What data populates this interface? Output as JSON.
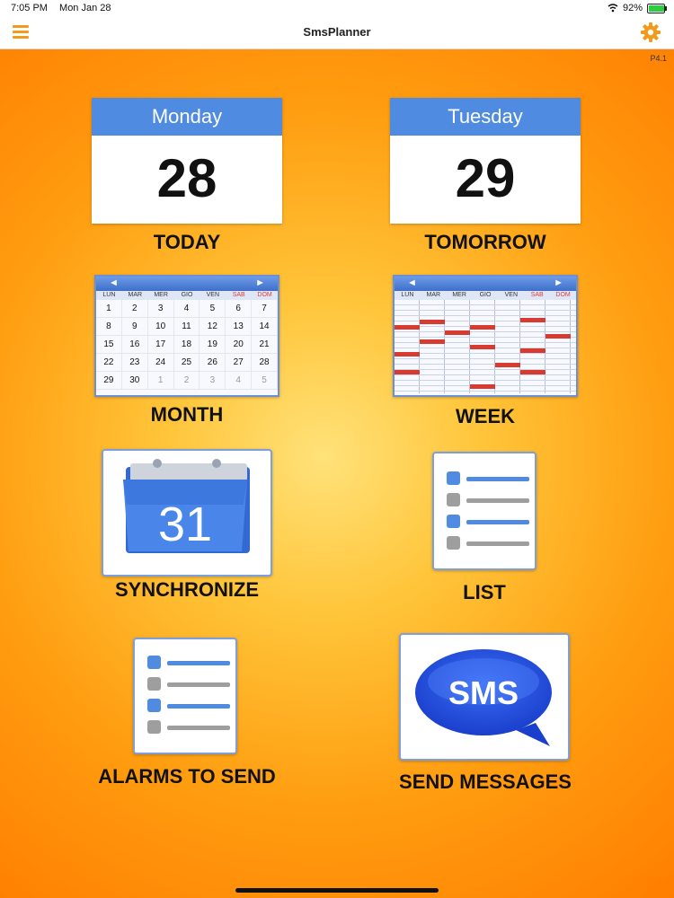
{
  "status_bar": {
    "time": "7:05 PM",
    "date": "Mon Jan 28",
    "battery": "92%",
    "battery_level": 0.92
  },
  "nav": {
    "title": "SmsPlanner",
    "version": "P4.1"
  },
  "today": {
    "weekday": "Monday",
    "day": "28",
    "label": "TODAY"
  },
  "tomorrow": {
    "weekday": "Tuesday",
    "day": "29",
    "label": "TOMORROW"
  },
  "calendar_days": [
    "LUN",
    "MAR",
    "MER",
    "GIO",
    "VEN",
    "SAB",
    "DOM"
  ],
  "month": {
    "label": "MONTH",
    "rows": [
      [
        "1",
        "2",
        "3",
        "4",
        "5",
        "6",
        "7"
      ],
      [
        "8",
        "9",
        "10",
        "11",
        "12",
        "13",
        "14"
      ],
      [
        "15",
        "16",
        "17",
        "18",
        "19",
        "20",
        "21"
      ],
      [
        "22",
        "23",
        "24",
        "25",
        "26",
        "27",
        "28"
      ],
      [
        "29",
        "30",
        "1",
        "2",
        "3",
        "4",
        "5"
      ]
    ]
  },
  "week": {
    "label": "WEEK"
  },
  "synchronize": {
    "label": "SYNCHRONIZE",
    "icon_number": "31"
  },
  "list": {
    "label": "LIST"
  },
  "alarms": {
    "label": "ALARMS TO SEND"
  },
  "send": {
    "label": "SEND MESSAGES",
    "icon_text": "SMS"
  },
  "icons": {
    "menu": "menu-icon",
    "settings": "gear-icon",
    "left": "◄",
    "right": "►"
  },
  "colors": {
    "accent": "#f29a1c",
    "calendar_blue": "#4f8be0",
    "event_red": "#d73a2e"
  }
}
